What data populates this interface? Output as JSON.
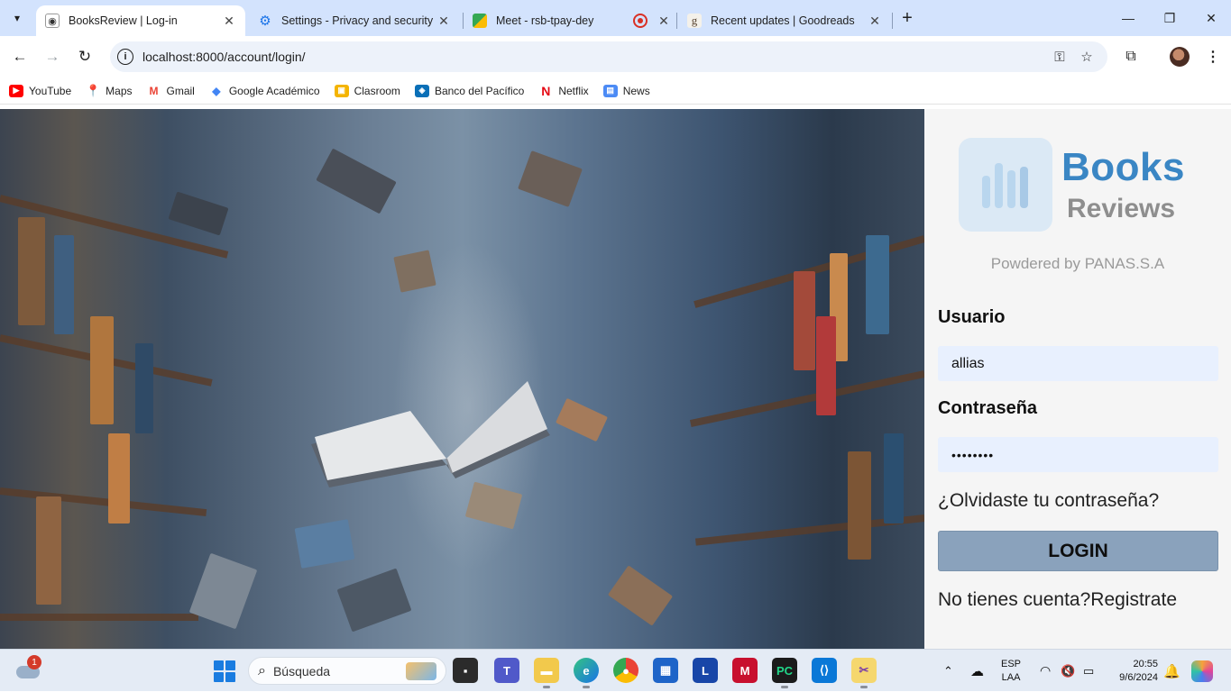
{
  "browser": {
    "tabs": [
      {
        "title": "BooksReview | Log-in",
        "active": true,
        "icon": "book-favicon"
      },
      {
        "title": "Settings - Privacy and security",
        "active": false,
        "icon": "gear-icon"
      },
      {
        "title": "Meet - rsb-tpay-dey",
        "active": false,
        "icon": "meet-icon"
      },
      {
        "title": "",
        "active": false,
        "icon": "record-icon"
      },
      {
        "title": "Recent updates | Goodreads",
        "active": false,
        "icon": "goodreads-icon"
      }
    ],
    "url": "localhost:8000/account/login/",
    "bookmarks": [
      {
        "label": "YouTube",
        "color": "#ff0000"
      },
      {
        "label": "Maps",
        "color": "#34a853"
      },
      {
        "label": "Gmail",
        "color": "#ea4335"
      },
      {
        "label": "Google Académico",
        "color": "#4285f4"
      },
      {
        "label": "Clasroom",
        "color": "#f4b400"
      },
      {
        "label": "Banco del Pacífico",
        "color": "#0a6fb7"
      },
      {
        "label": "Netflix",
        "color": "#e50914"
      },
      {
        "label": "News",
        "color": "#4c8bf5"
      }
    ]
  },
  "login": {
    "logo_title": "Books",
    "logo_subtitle": "Reviews",
    "powered_by": "Powdered by PANAS.S.A",
    "username_label": "Usuario",
    "username_value": "allias",
    "password_label": "Contraseña",
    "password_value": "••••••••",
    "forgot_link": "¿Olvidaste tu contraseña?",
    "login_button": "LOGIN",
    "register_link": "No tienes cuenta?Registrate"
  },
  "taskbar": {
    "weather_badge": "1",
    "search_placeholder": "Búsqueda",
    "language": "ESP",
    "keyboard": "LAA",
    "time": "20:55",
    "date": "9/6/2024"
  },
  "colors": {
    "accent_blue": "#3a86c4",
    "login_button": "#8aa2bc",
    "field_bg": "#e8f0fe"
  }
}
